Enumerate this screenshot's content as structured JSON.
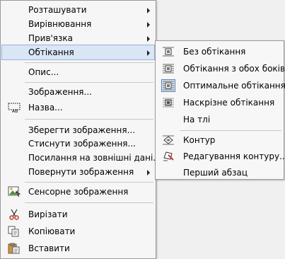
{
  "main_menu": {
    "items": [
      {
        "label": "Розташувати",
        "submenu": true
      },
      {
        "label": "Вирівнювання",
        "submenu": true
      },
      {
        "label": "Прив'язка",
        "submenu": true
      },
      {
        "label": "Обтікання",
        "submenu": true,
        "highlighted": true
      },
      {
        "label": "Опис..."
      },
      {
        "label": "Зображення..."
      },
      {
        "label": "Назва...",
        "icon": "caption-icon"
      },
      {
        "label": "Зберегти зображення..."
      },
      {
        "label": "Стиснути зображення..."
      },
      {
        "label": "Посилання на зовнішні дані..."
      },
      {
        "label": "Повернути зображення",
        "submenu": true
      },
      {
        "label": "Сенсорне зображення",
        "icon": "image-map-icon"
      },
      {
        "label": "Вирізати",
        "icon": "scissors-icon"
      },
      {
        "label": "Копіювати",
        "icon": "copy-icon"
      },
      {
        "label": "Вставити",
        "icon": "clipboard-paste-icon"
      }
    ]
  },
  "wrap_submenu": {
    "items": [
      {
        "label": "Без обтікання",
        "icon": "wrap-off-icon"
      },
      {
        "label": "Обтікання з обох боків",
        "icon": "wrap-parallel-icon"
      },
      {
        "label": "Оптимальне обтікання",
        "icon": "wrap-optimal-icon",
        "selected": true
      },
      {
        "label": "Наскрізне обтікання",
        "icon": "wrap-through-icon"
      },
      {
        "label": "На тлі"
      },
      {
        "label": "Контур",
        "icon": "contour-icon"
      },
      {
        "label": "Редагування контуру...",
        "icon": "edit-contour-icon"
      },
      {
        "label": "Перший абзац"
      }
    ]
  },
  "colors": {
    "highlight": "#d9e6f5",
    "highlight_border": "#99b4d6",
    "menu_bg": "#f6f6f6"
  }
}
